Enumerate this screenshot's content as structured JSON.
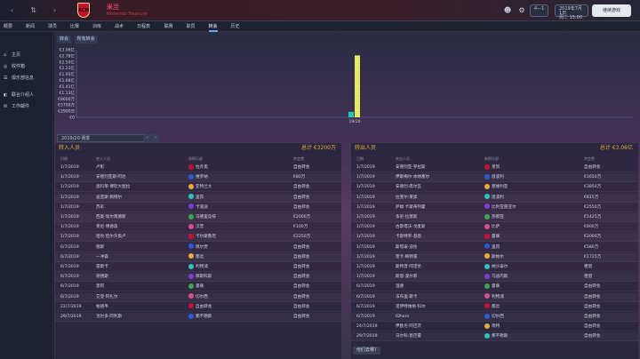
{
  "top": {
    "club_name": "米兰",
    "club_subtitle": "Nintendo Treasure",
    "date_line1": "2019年7月1日",
    "date_line2": "周二 15:00",
    "continue_label": "继续游戏",
    "pill_label": "4—1"
  },
  "menu": [
    "概要",
    "新闻",
    "球员",
    "比赛",
    "训练",
    "战术",
    "日程表",
    "联赛",
    "职员",
    "转会",
    "历史"
  ],
  "menu_active_index": 9,
  "sidebar": [
    {
      "icon": "⌂",
      "label": "主页"
    },
    {
      "icon": "◎",
      "label": "收件箱"
    },
    {
      "icon": "☰",
      "label": "俱乐部信息"
    },
    {
      "icon": "◐",
      "label": "联合介绍人"
    },
    {
      "icon": "✉",
      "label": "工作邮件"
    }
  ],
  "chart_filter": {
    "label": "转会",
    "selected": "所有转会"
  },
  "chart_data": {
    "type": "bar",
    "categories": [
      "19/20"
    ],
    "series": [
      {
        "name": "",
        "color": "#2ec4b6",
        "values": [
          0.25
        ]
      },
      {
        "name": "",
        "color": "#e8ef6a",
        "values": [
          2.8
        ]
      }
    ],
    "ylabels": [
      "€3.06亿",
      "€2.78亿",
      "€2.50亿",
      "€2.23亿",
      "€1.95亿",
      "€1.68亿",
      "€1.41亿",
      "€1.13亿",
      "€8600万",
      "€5700万",
      "€2900万",
      "€0"
    ],
    "ylim": [
      0,
      3.06
    ],
    "xlabel_text": "19/20"
  },
  "season_label": "2019/20 赛季",
  "left_panel": {
    "title": "转入人员",
    "total": "总计 €3200万",
    "cols": [
      "日期",
      "转入人员",
      "原俱乐部",
      "转会费"
    ],
    "rows": [
      [
        "1/7/2019",
        "卢彰",
        "拉齐奥",
        "自由转会"
      ],
      [
        "1/7/2019",
        "安德烈亚斯·阿达",
        "维罗纳",
        "€80万"
      ],
      [
        "1/7/2019",
        "恩科莱·博钦大图拉",
        "亚特兰大",
        "自由转会"
      ],
      [
        "1/7/2019",
        "迪亚斯·佩特尔",
        "里昂",
        "自由转会"
      ],
      [
        "1/7/2019",
        "苏彩",
        "卡波迪",
        "自由转会"
      ],
      [
        "1/7/2019",
        "西奥·埃尔南德斯",
        "马德里竞技",
        "€2000万"
      ],
      [
        "1/7/2019",
        "莱尼·博德森",
        "汉堡",
        "€100万"
      ],
      [
        "1/7/2019",
        "哈坎·恰尔汗奥卢",
        "卡尔斯鲁厄",
        "€2250万"
      ],
      [
        "6/7/2019",
        "德斯",
        "佩尔贾",
        "自由转会"
      ],
      [
        "6/7/2019",
        "一冲森",
        "都灵",
        "自由转会"
      ],
      [
        "6/7/2019",
        "雷斯卡",
        "利物浦",
        "自由转会"
      ],
      [
        "6/7/2019",
        "德德斯",
        "摩斯科斯",
        "自由转会"
      ],
      [
        "6/7/2019",
        "莫阿",
        "曼联",
        "自由转会"
      ],
      [
        "6/7/2019",
        "艾登·阿扎尔",
        "切尔西",
        "自由转会"
      ],
      [
        "22/7/2019",
        "帕德韦",
        "自由转会",
        "自由转会"
      ],
      [
        "29/7/2019",
        "戈尔多·阿利斯",
        "那不勒斯",
        "自由转会"
      ]
    ]
  },
  "right_panel": {
    "title": "转出人员",
    "total": "总计 €3.06亿",
    "cols": [
      "日期",
      "转出人员",
      "新俱乐部",
      "转会费"
    ],
    "rows": [
      [
        "1/7/2019",
        "安德烈亚·罗拉斯",
        "莱凯",
        "自由转会"
      ],
      [
        "1/7/2019",
        "伊斯梅尔·本纳塞尔",
        "恩波利",
        "€1650万"
      ],
      [
        "1/7/2019",
        "安德烈·席尔瓦",
        "塞维利亚",
        "€3850万"
      ],
      [
        "1/7/2019",
        "拉斐尔·莱奥",
        "恩波利",
        "€815万"
      ],
      [
        "1/7/2019",
        "萨姆·卡斯蒂列霍",
        "比利亚雷亚尔",
        "€2550万"
      ],
      [
        "1/7/2019",
        "多尼·拉莫斯",
        "热那亚",
        "€1425万"
      ],
      [
        "1/7/2019",
        "古斯塔沃·戈麦斯",
        "比萨",
        "€800万"
      ],
      [
        "1/7/2019",
        "卡斯特罗·基恩",
        "曼联",
        "€2000万"
      ],
      [
        "1/7/2019",
        "斯塔泰·迪佐",
        "里昂",
        "€580万"
      ],
      [
        "1/7/2019",
        "奎卡·梅特雷",
        "斯帕尔",
        "€1725万"
      ],
      [
        "1/7/2019",
        "斯特普·阿诺伦",
        "纳沙泰尔",
        "租借"
      ],
      [
        "1/7/2019",
        "斯恩·波尔菲",
        "乌迪内斯",
        "租借"
      ],
      [
        "6/7/2019",
        "温德",
        "曼联",
        "自由转会"
      ],
      [
        "6/7/2019",
        "法布里·斯卡",
        "利物浦",
        "自由转会"
      ],
      [
        "6/7/2019",
        "诺伊特维格·科尔",
        "都灵",
        "自由转会"
      ],
      [
        "6/7/2019",
        "IDhoro",
        "切尔西",
        "自由转会"
      ],
      [
        "24/7/2019",
        "伊欧尼·阿巴茨",
        "南特",
        "自由转会"
      ],
      [
        "29/7/2019",
        "马尔科·恩巴雷",
        "那不勒斯",
        "自由转会"
      ]
    ]
  },
  "more_label": "他们去哪?"
}
